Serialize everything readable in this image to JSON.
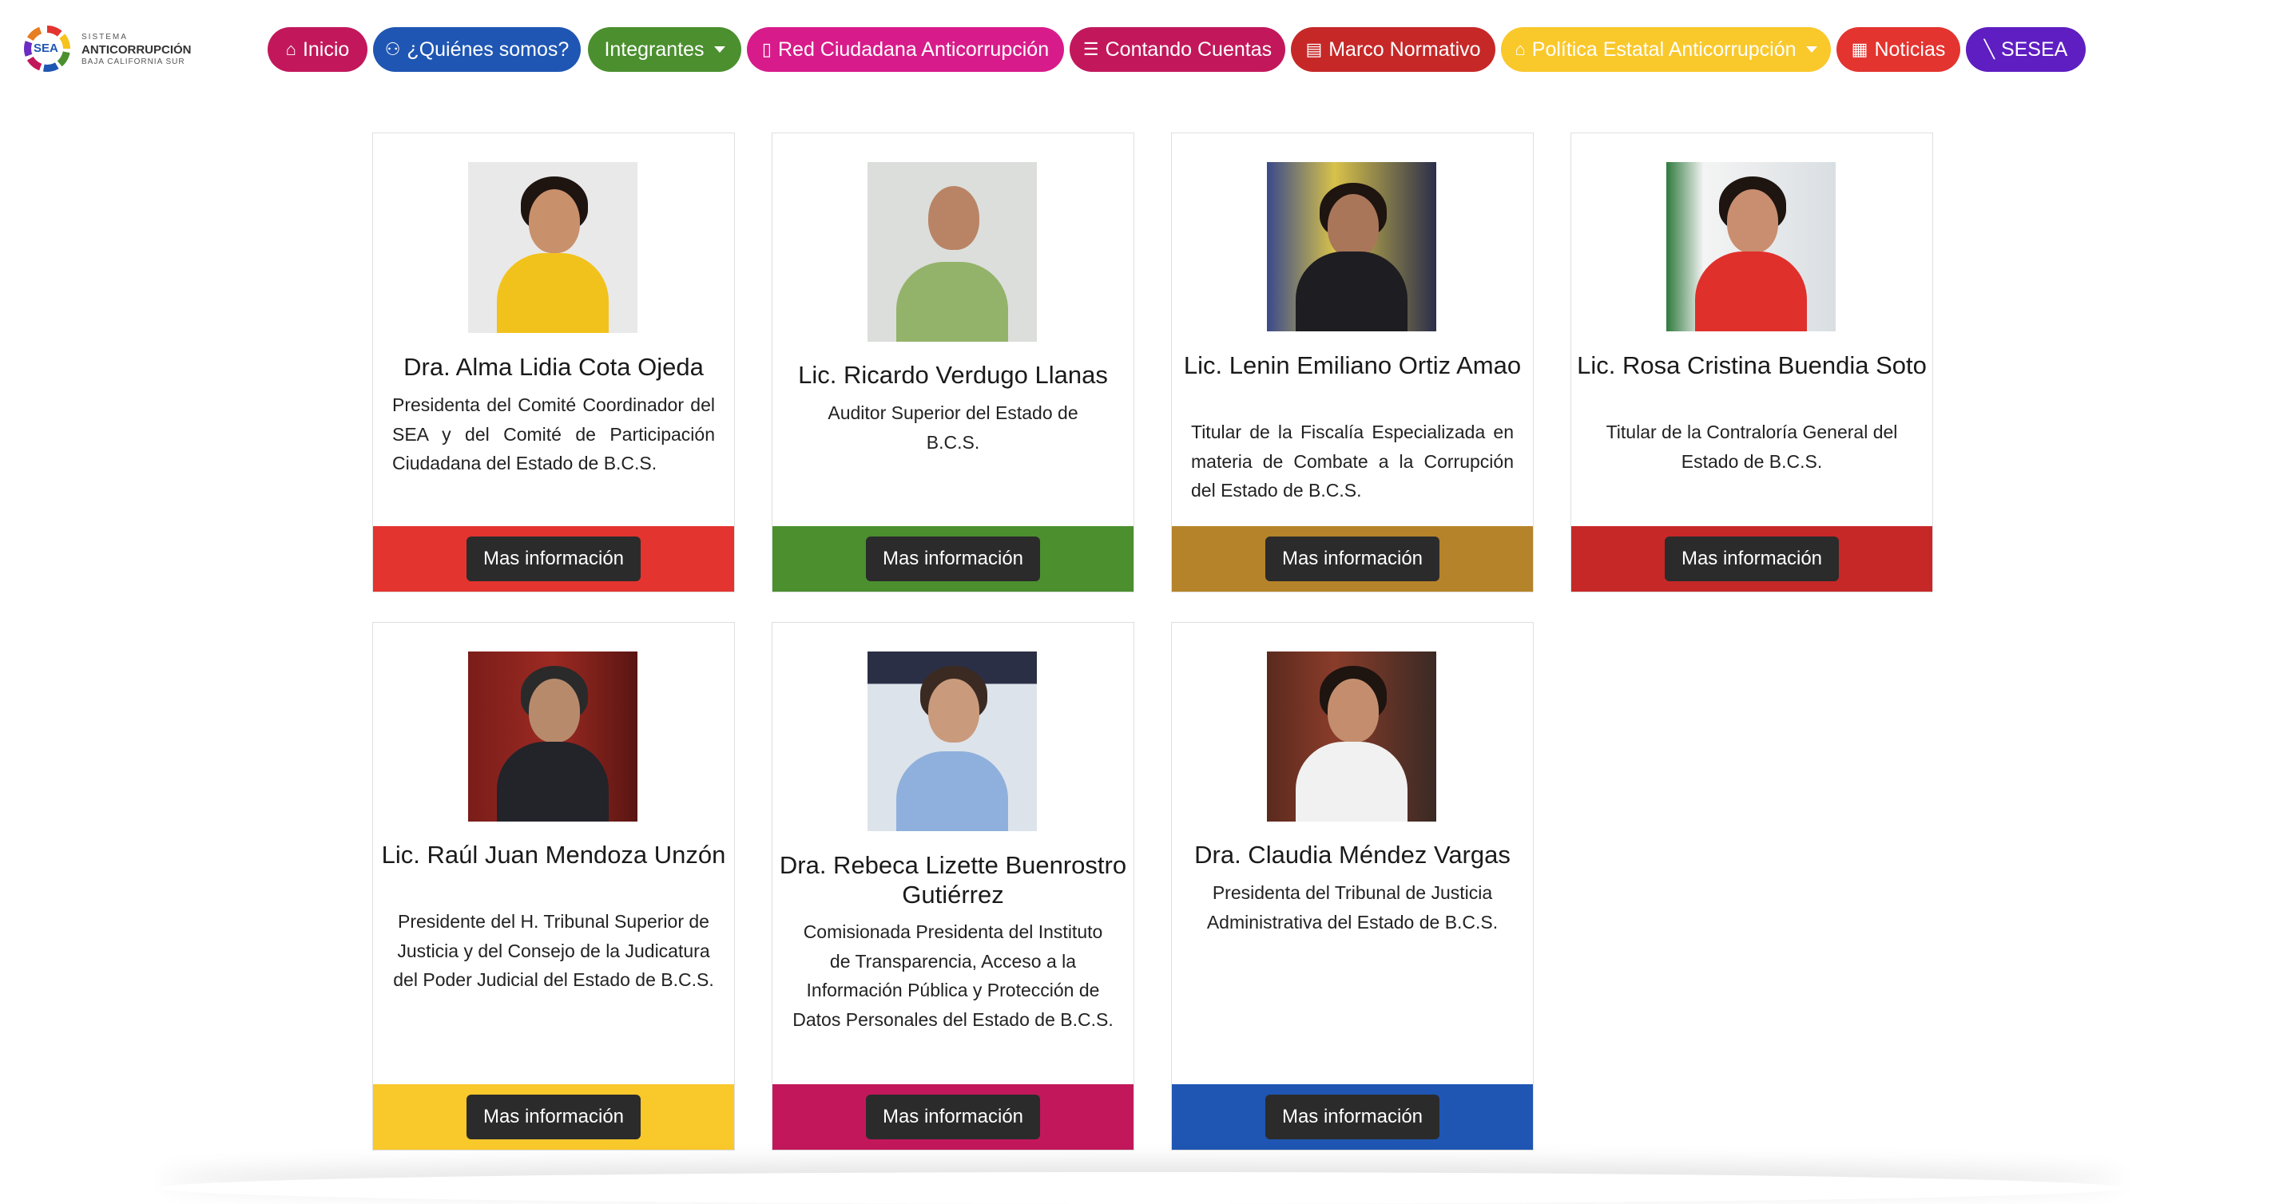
{
  "logo": {
    "mark": "SEA",
    "line1": "SISTEMA",
    "line2": "ANTICORRUPCIÓN",
    "line3": "BAJA CALIFORNIA SUR"
  },
  "nav": {
    "items": [
      {
        "label": "Inicio",
        "icon": "home-icon",
        "color": "#c2185b"
      },
      {
        "label": "¿Quiénes somos?",
        "icon": "people-icon",
        "color": "#1f56b3"
      },
      {
        "label": "Integrantes",
        "icon": "",
        "color": "#4b8f2f"
      },
      {
        "label": "Red Ciudadana Anticorrupción",
        "icon": "book-icon",
        "color": "#d81b8a"
      },
      {
        "label": "Contando Cuentas",
        "icon": "list-icon",
        "color": "#c2185b"
      },
      {
        "label": "Marco Normativo",
        "icon": "journal-icon",
        "color": "#c62828"
      },
      {
        "label": "Política Estatal Anticorrupción",
        "icon": "building-icon",
        "color": "#f9c82b"
      },
      {
        "label": "Noticias",
        "icon": "newspaper-icon",
        "color": "#e3342f"
      },
      {
        "label": "SESEA",
        "icon": "magic-icon",
        "color": "#5e1ec2"
      }
    ]
  },
  "members": [
    {
      "name": "Dra. Alma Lidia Cota Ojeda",
      "role": "Presidenta del Comité Coordinador del SEA y del Comité de Participación Ciudadana del Estado de B.C.S.",
      "button": "Mas información",
      "color": "#e3342f"
    },
    {
      "name": "Lic. Ricardo Verdugo Llanas",
      "role": "Auditor Superior del Estado de B.C.S.",
      "button": "Mas información",
      "color": "#4b8f2f"
    },
    {
      "name": "Lic. Lenin Emiliano Ortiz Amao",
      "role": "Titular de la Fiscalía Especializada en materia de Combate a la Corrupción del Estado de B.C.S.",
      "button": "Mas información",
      "color": "#b5832a"
    },
    {
      "name": "Lic. Rosa Cristina Buendia Soto",
      "role": "Titular de la Contraloría General del Estado de B.C.S.",
      "button": "Mas información",
      "color": "#c62828"
    },
    {
      "name": "Lic. Raúl Juan Mendoza Unzón",
      "role": "Presidente del H. Tribunal Superior de Justicia y del Consejo de la Judicatura del Poder Judicial del Estado de B.C.S.",
      "button": "Mas información",
      "color": "#f9c82b"
    },
    {
      "name": "Dra. Rebeca Lizette Buenrostro Gutiérrez",
      "role": "Comisionada Presidenta del Instituto de Transparencia, Acceso a la Información Pública y Protección de Datos Personales del Estado de B.C.S.",
      "button": "Mas información",
      "color": "#c2185b"
    },
    {
      "name": "Dra. Claudia Méndez Vargas",
      "role": "Presidenta del Tribunal de Justicia Administrativa del Estado de B.C.S.",
      "button": "Mas información",
      "color": "#1f56b3"
    }
  ]
}
